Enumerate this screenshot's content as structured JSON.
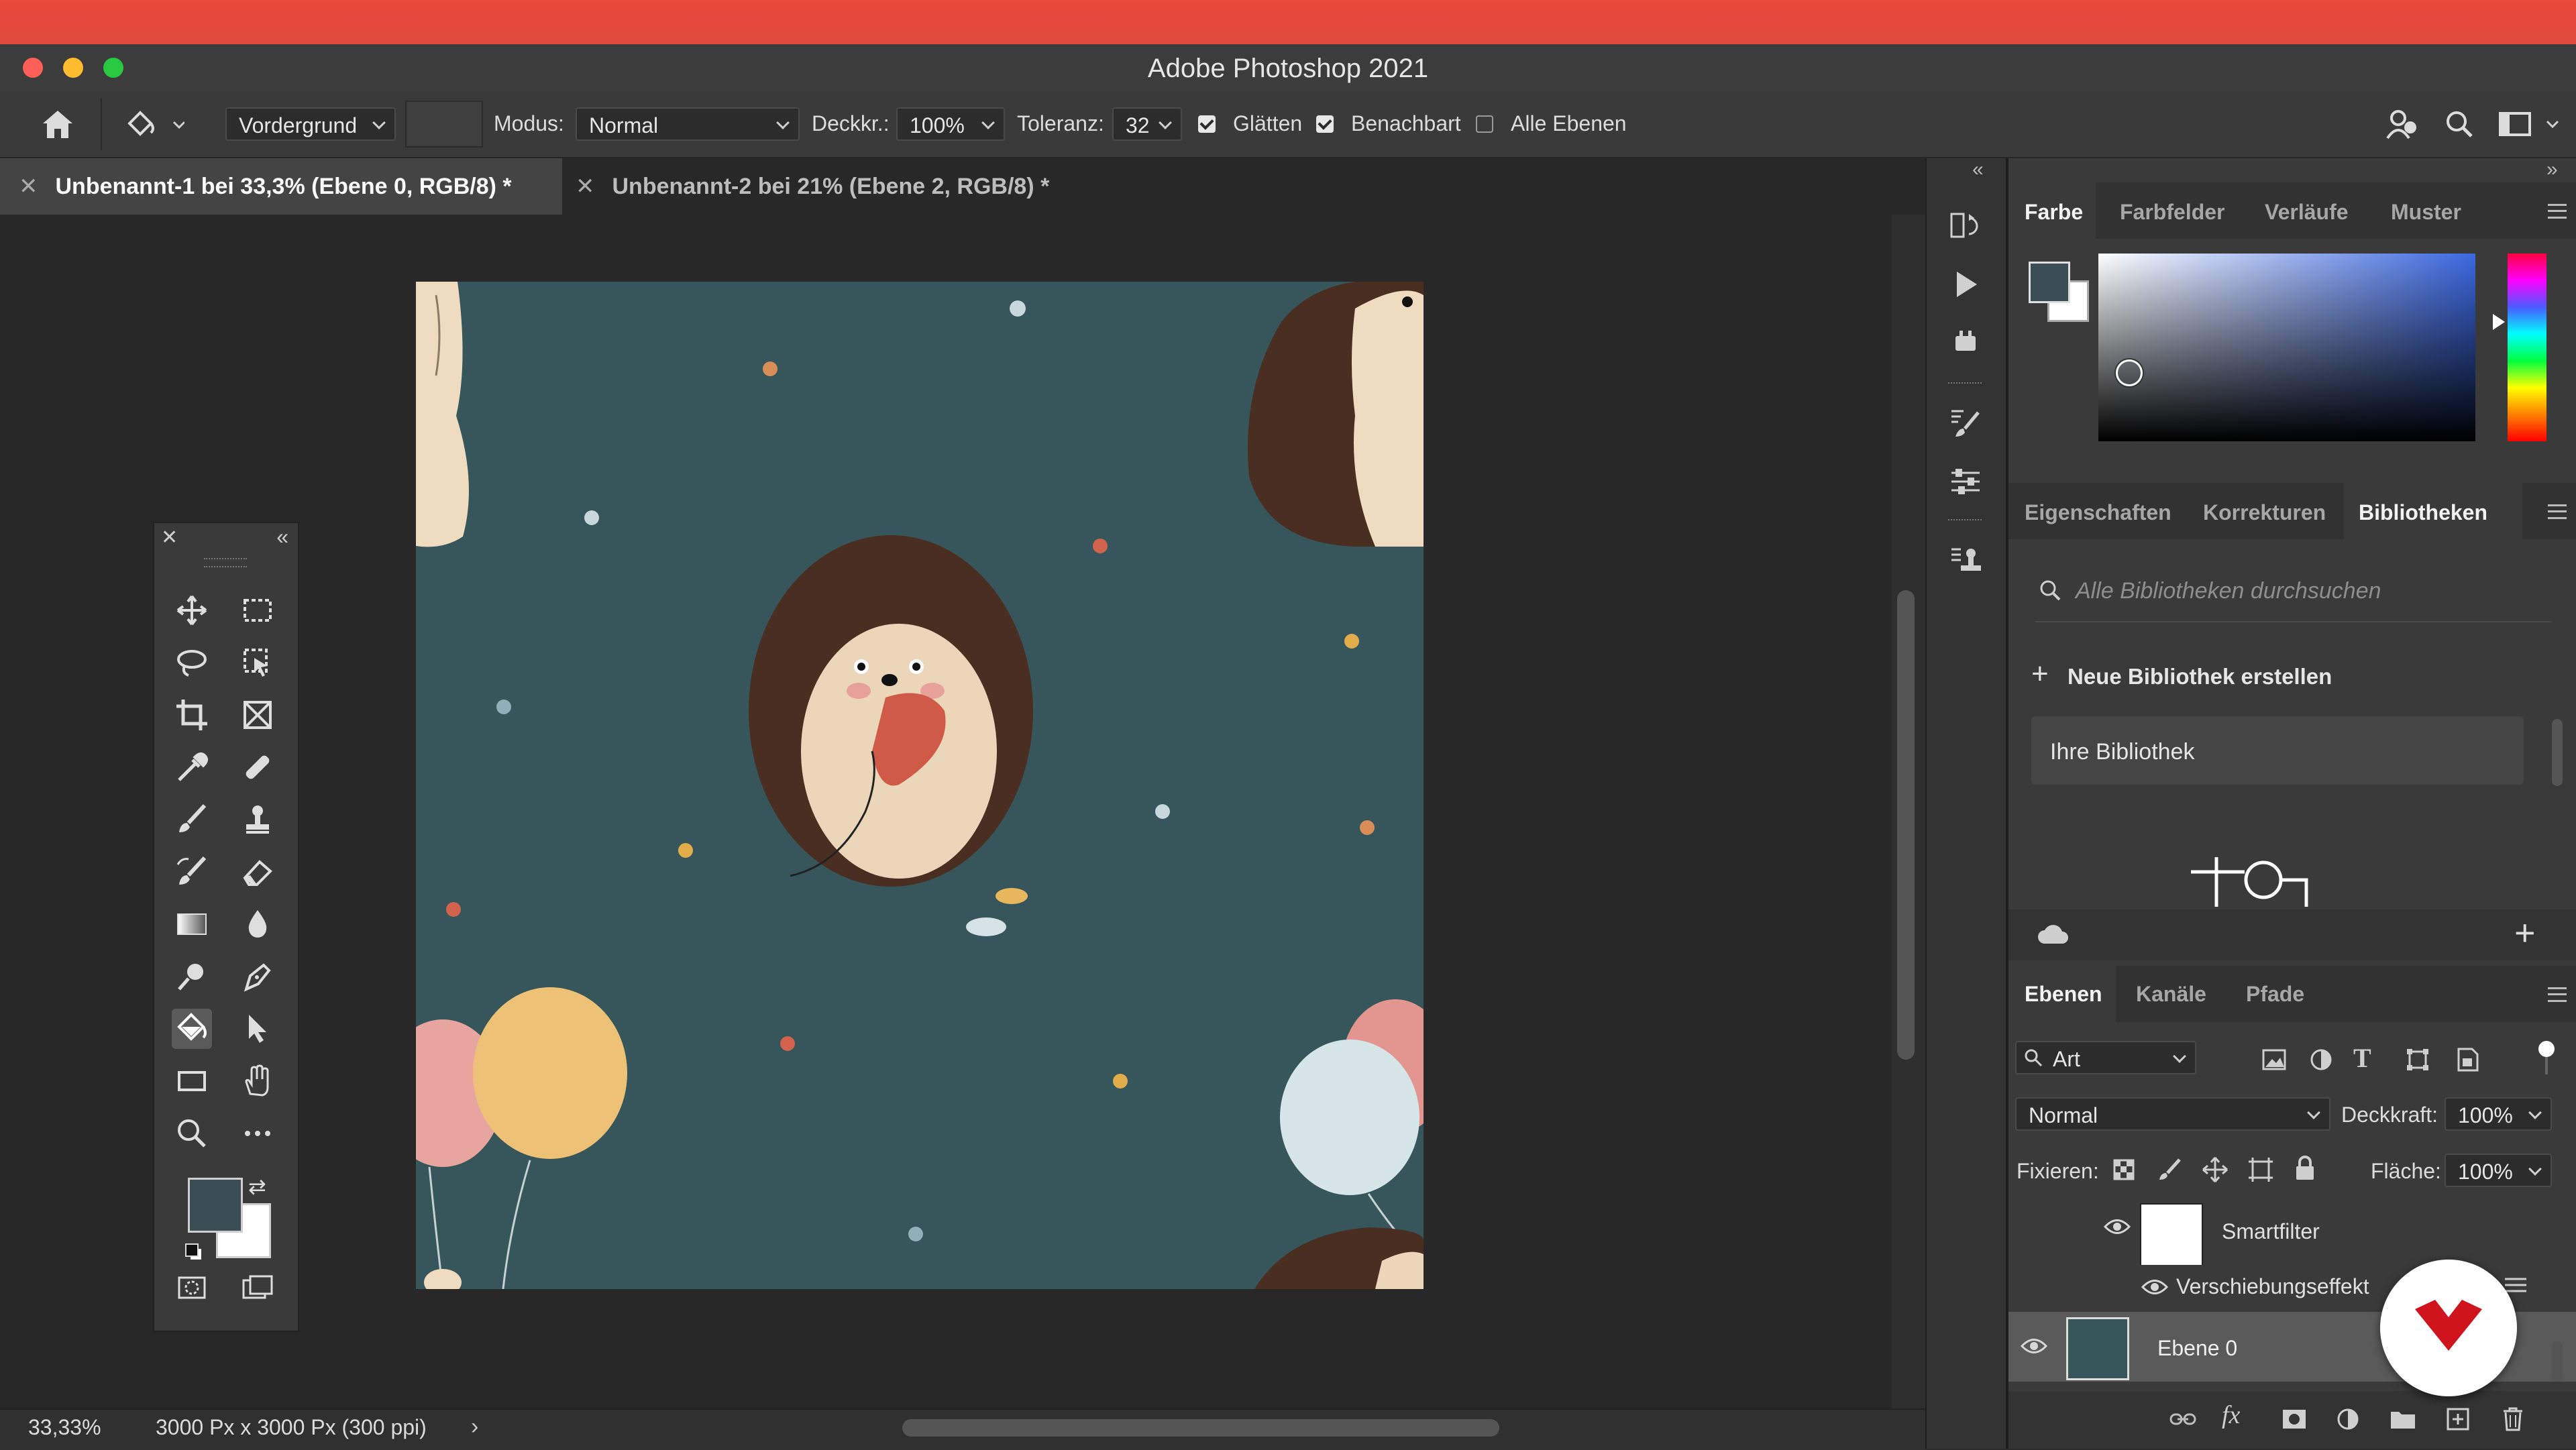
{
  "window": {
    "title": "Adobe Photoshop 2021",
    "traffic_colors": [
      "#fe5f57",
      "#febc2e",
      "#28c840"
    ]
  },
  "options_bar": {
    "fill_source": "Vordergrund",
    "mode_label": "Modus:",
    "mode_value": "Normal",
    "opacity_label": "Deckkr.:",
    "opacity_value": "100%",
    "tolerance_label": "Toleranz:",
    "tolerance_value": "32",
    "antialias_label": "Glätten",
    "antialias_checked": true,
    "contiguous_label": "Benachbart",
    "contiguous_checked": true,
    "all_layers_label": "Alle Ebenen",
    "all_layers_checked": false
  },
  "doc_tabs": [
    {
      "label": "Unbenannt-1 bei 33,3% (Ebene 0, RGB/8) *",
      "active": true
    },
    {
      "label": "Unbenannt-2 bei 21% (Ebene 2, RGB/8) *",
      "active": false
    }
  ],
  "status": {
    "zoom": "33,33%",
    "doc_info": "3000 Px x 3000 Px (300 ppi)"
  },
  "color_panel": {
    "tabs": [
      "Farbe",
      "Farbfelder",
      "Verläufe",
      "Muster"
    ],
    "active": "Farbe",
    "foreground_color": "#3d4d55",
    "background_color": "#ffffff"
  },
  "libraries_panel": {
    "tabs": [
      "Eigenschaften",
      "Korrekturen",
      "Bibliotheken"
    ],
    "active": "Bibliotheken",
    "search_placeholder": "Alle Bibliotheken durchsuchen",
    "new_library_label": "Neue Bibliothek erstellen",
    "library_item": "Ihre Bibliothek"
  },
  "layers_panel": {
    "tabs": [
      "Ebenen",
      "Kanäle",
      "Pfade"
    ],
    "active": "Ebenen",
    "filter_kind": "Art",
    "blend_mode": "Normal",
    "opacity_label": "Deckkraft:",
    "opacity_value": "100%",
    "lock_label": "Fixieren:",
    "fill_label": "Fläche:",
    "fill_value": "100%",
    "layers": [
      {
        "name": "Smartfilter",
        "type": "smart-filter-mask"
      },
      {
        "name": "Verschiebungseffekt",
        "type": "filter"
      },
      {
        "name": "Ebene 0",
        "type": "layer",
        "selected": true
      }
    ]
  },
  "canvas": {
    "background": "#36565c"
  }
}
